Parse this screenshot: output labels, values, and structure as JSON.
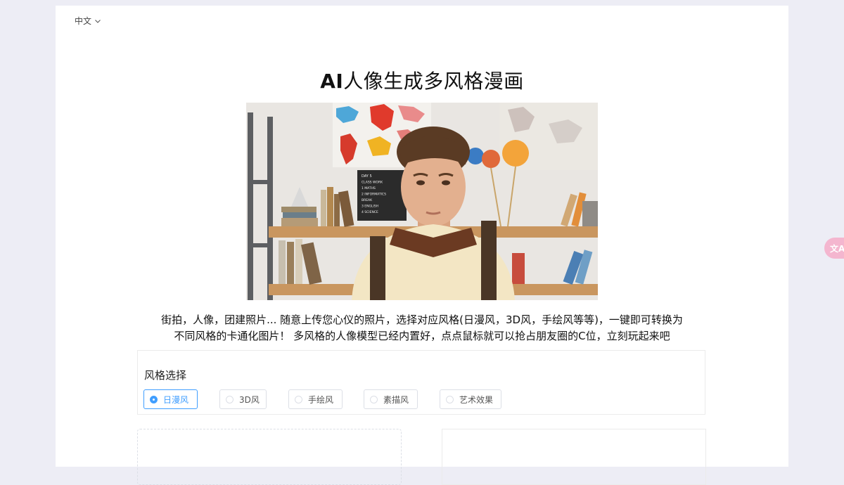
{
  "header": {
    "language": "中文",
    "language_icon": "chevron-down-icon"
  },
  "title": {
    "bold": "AI",
    "rest": "人像生成多风格漫画"
  },
  "description": {
    "line1": "街拍，人像，团建照片... 随意上传您心仪的照片，选择对应风格(日漫风，3D风，手绘风等等)，一键即可转换为",
    "line2": "不同风格的卡通化图片！ 多风格的人像模型已经内置好，点点鼠标就可以抢占朋友圈的C位，立刻玩起来吧"
  },
  "style_select": {
    "label": "风格选择",
    "options": [
      "日漫风",
      "3D风",
      "手绘风",
      "素描风",
      "艺术效果"
    ],
    "selected": "日漫风"
  },
  "hero_board": {
    "lines": [
      "DAY 5",
      "CLASS WORK",
      "1 MATHS",
      "2 INFORMATICS",
      "BREAK",
      "3 ENGLISH",
      "4 SCIENCE"
    ]
  },
  "floating_button": {
    "icon": "translate-icon",
    "glyph": "文A"
  },
  "colors": {
    "accent": "#409eff",
    "background": "#ededf5",
    "float_button": "#f4b6cf"
  }
}
